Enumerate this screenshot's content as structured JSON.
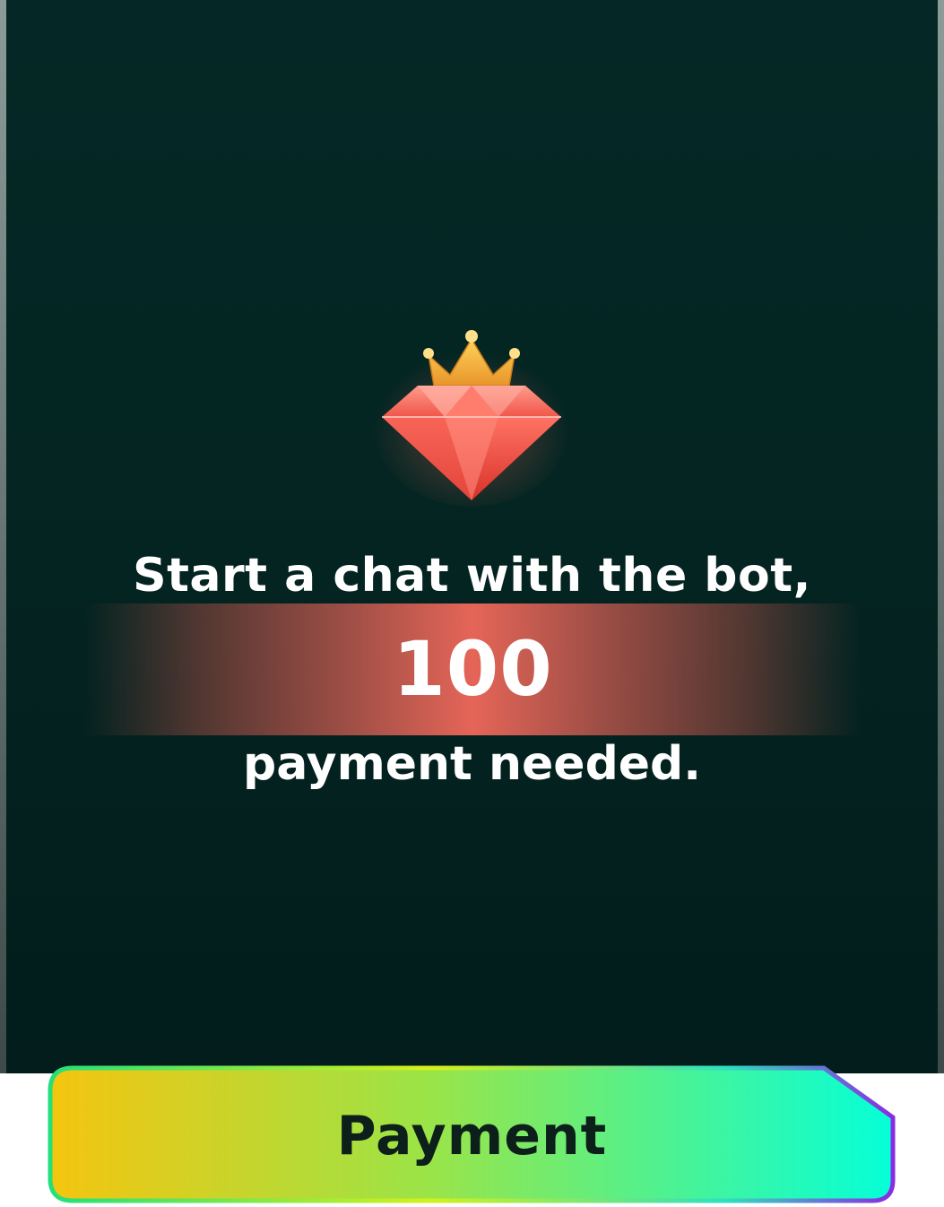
{
  "dialog": {
    "line1": "Start a chat with the bot,",
    "amount": "100",
    "line2": "payment needed.",
    "icon": "crown-diamond-icon"
  },
  "payment_button": {
    "label": "Payment"
  },
  "colors": {
    "panel_background": "#042522",
    "accent_band": "#e56558",
    "button_gradient_start": "#f5c50f",
    "button_gradient_end": "#05ffd8",
    "button_text": "#0d1f1a",
    "button_border_accent": "#8a2be2"
  }
}
